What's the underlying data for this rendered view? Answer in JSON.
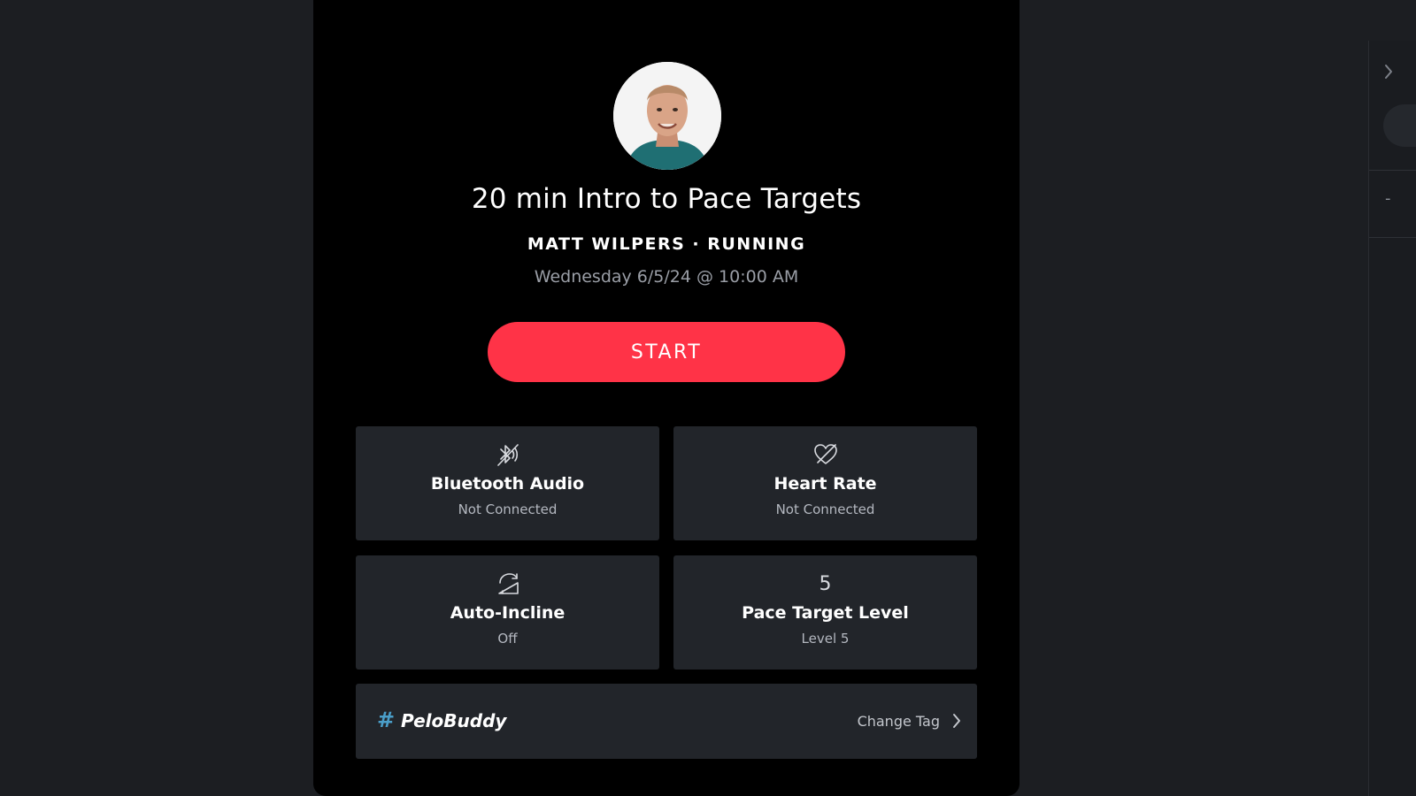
{
  "class": {
    "title": "20 min Intro to Pace Targets",
    "subtitle": "MATT WILPERS · RUNNING",
    "datetime": "Wednesday 6/5/24 @ 10:00 AM",
    "start_label": "START"
  },
  "tiles": [
    {
      "icon": "bluetooth-audio-off-icon",
      "label": "Bluetooth Audio",
      "status": "Not Connected"
    },
    {
      "icon": "heart-rate-off-icon",
      "label": "Heart Rate",
      "status": "Not Connected"
    },
    {
      "icon": "auto-incline-icon",
      "label": "Auto-Incline",
      "status": "Off"
    },
    {
      "icon_text": "5",
      "label": "Pace Target Level",
      "status": "Level 5"
    }
  ],
  "tag": {
    "hash": "#",
    "name": "PeloBuddy",
    "change_label": "Change Tag"
  },
  "side_panel": {
    "dash": "-"
  },
  "colors": {
    "background": "#1c1e22",
    "modal": "#000000",
    "accent_start": "#ff3347",
    "tile": "#22252a",
    "hashtag": "#4a9ec9"
  }
}
